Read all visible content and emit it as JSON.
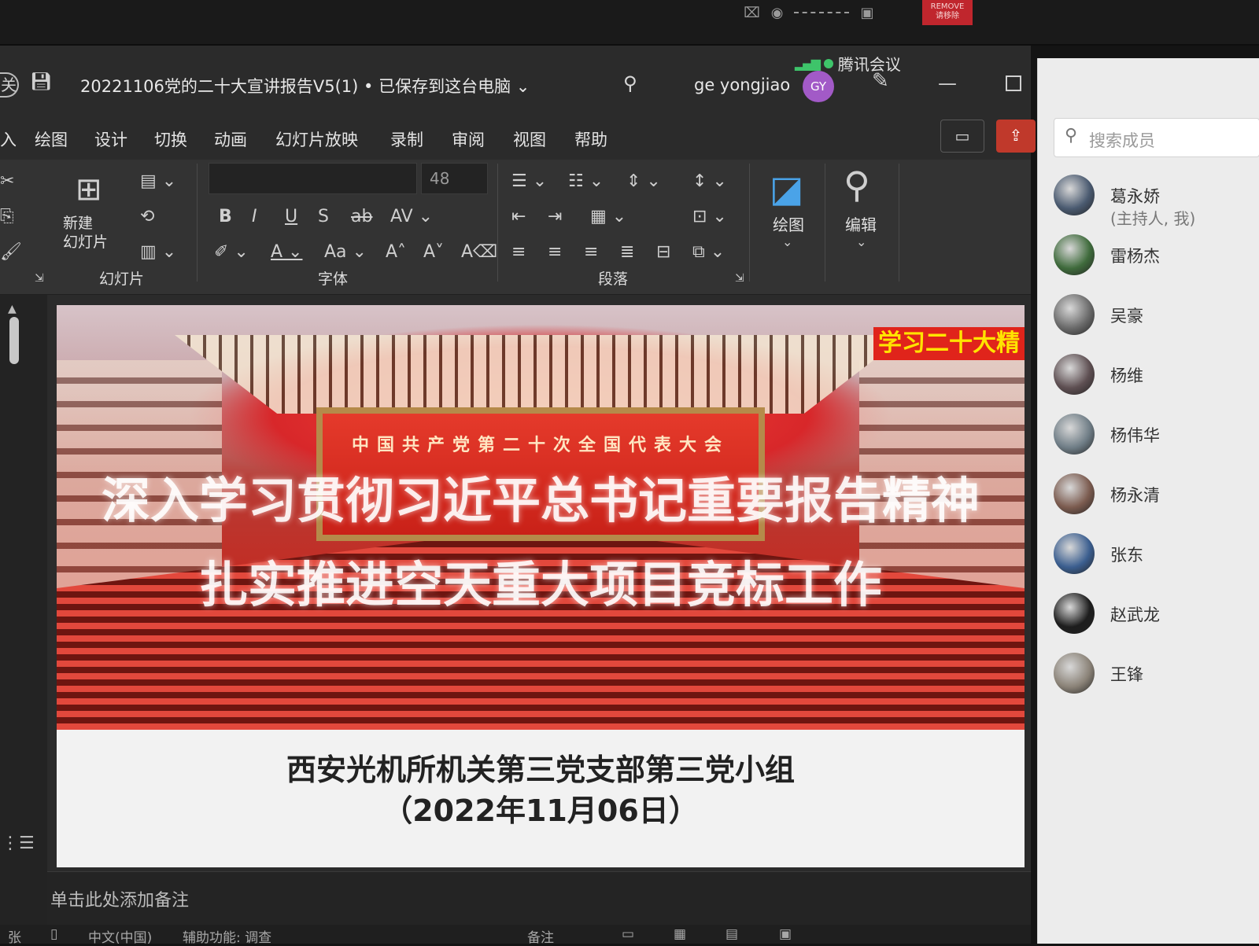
{
  "bezel": {
    "remove_label": "REMOVE\n请移除"
  },
  "window": {
    "doc_title": "20221106党的二十大宣讲报告V5(1) • 已保存到这台电脑 ⌄",
    "user_name": "ge yongjiao",
    "avatar_initials": "GY",
    "meeting_app": "腾讯会议"
  },
  "menu": [
    "绘图",
    "设计",
    "切换",
    "动画",
    "幻灯片放映",
    "录制",
    "审阅",
    "视图",
    "帮助"
  ],
  "ribbon": {
    "new_slide_label": "新建\n幻灯片",
    "slides_group": "幻灯片",
    "font_group": "字体",
    "paragraph_group": "段落",
    "draw_label": "绘图",
    "edit_label": "编辑",
    "font_size": "48"
  },
  "slide": {
    "banner": "中国共产党第二十次全国代表大会",
    "headline1": "深入学习贯彻习近平总书记重要报告精神",
    "headline2": "扎实推进空天重大项目竞标工作",
    "corner_tag": "学习二十大精",
    "org": "西安光机所机关第三党支部第三党小组",
    "date": "（2022年11月06日）"
  },
  "notes_placeholder": "单击此处添加备注",
  "status": {
    "language": "中文(中国)",
    "accessibility": "辅助功能: 调查",
    "notes_btn": "备注"
  },
  "panel": {
    "search_placeholder": "搜索成员",
    "members": [
      {
        "name": "葛永娇",
        "sub": "(主持人, 我)",
        "color": "#4a5a70"
      },
      {
        "name": "雷杨杰",
        "sub": "",
        "color": "#3f6b3c"
      },
      {
        "name": "吴豪",
        "sub": "",
        "color": "#6a6a6a"
      },
      {
        "name": "杨维",
        "sub": "",
        "color": "#5e4f52"
      },
      {
        "name": "杨伟华",
        "sub": "",
        "color": "#6f7d86"
      },
      {
        "name": "杨永清",
        "sub": "",
        "color": "#7b5b4f"
      },
      {
        "name": "张东",
        "sub": "",
        "color": "#3b5e8f"
      },
      {
        "name": "赵武龙",
        "sub": "",
        "color": "#1d1d1d"
      },
      {
        "name": "王锋",
        "sub": "",
        "color": "#8b8378"
      }
    ]
  }
}
